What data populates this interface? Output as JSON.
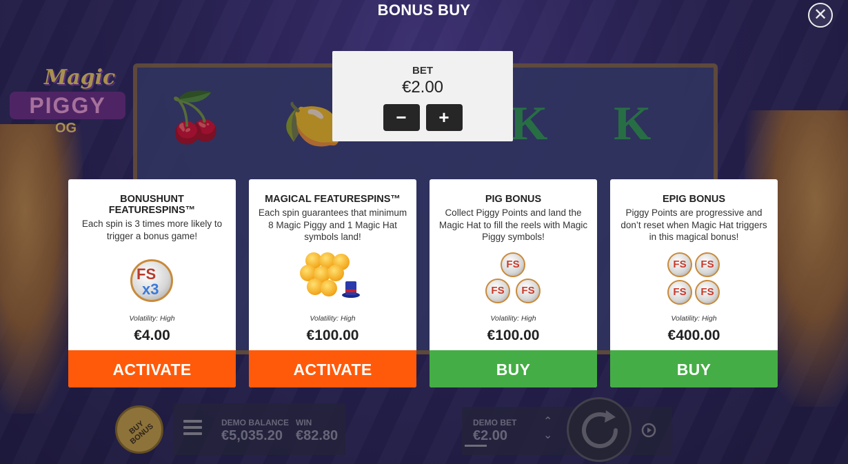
{
  "header": {
    "title": "BONUS BUY",
    "close_icon": "close-icon"
  },
  "bet": {
    "label": "BET",
    "value": "€2.00",
    "minus": "−",
    "plus": "+"
  },
  "cards": [
    {
      "title": "BONUSHUNT FEATURESPINS™",
      "description": "Each spin is 3 times more likely to trigger a bonus game!",
      "volatility": "Volatility: High",
      "price": "€4.00",
      "button": "ACTIVATE",
      "button_color": "#ff5a0a",
      "icon": "fs-x3-icon"
    },
    {
      "title": "MAGICAL FEATURESPINS™",
      "description": "Each spin guarantees that minimum 8 Magic Piggy and 1 Magic Hat symbols land!",
      "volatility": "Volatility: High",
      "price": "€100.00",
      "button": "ACTIVATE",
      "button_color": "#ff5a0a",
      "icon": "magic-piggy-hat-icon"
    },
    {
      "title": "PIG BONUS",
      "description": "Collect Piggy Points and land the Magic Hat to fill the reels with Magic Piggy symbols!",
      "volatility": "Volatility: High",
      "price": "€100.00",
      "button": "BUY",
      "button_color": "#45ad45",
      "icon": "three-fs-icon"
    },
    {
      "title": "EPIG BONUS",
      "description": "Piggy Points are progressive and don’t reset when Magic Hat triggers in this magical bonus!",
      "volatility": "Volatility: High",
      "price": "€400.00",
      "button": "BUY",
      "button_color": "#45ad45",
      "icon": "four-fs-icon"
    }
  ],
  "logo": {
    "top": "Magic",
    "middle": "PIGGY",
    "bottom": "OG"
  },
  "bottom_bar": {
    "buy_bonus": "BUY BONUS",
    "balance_label": "DEMO BALANCE",
    "balance_value": "€5,035.20",
    "win_label": "WIN",
    "win_value": "€82.80",
    "bet_label": "DEMO BET",
    "bet_value": "€2.00"
  },
  "icons": {
    "fs_text": "FS",
    "x3_text": "x3"
  }
}
